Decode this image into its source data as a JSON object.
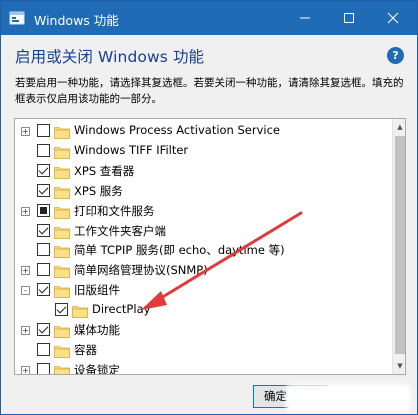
{
  "window": {
    "title": "Windows 功能",
    "heading": "启用或关闭 Windows 功能",
    "description": "若要启用一种功能，请选择其复选框。若要关闭一种功能，请清除其复选框。填充的框表示仅启用该功能的一部分。",
    "help_icon": "question-icon",
    "accent_color": "#1f6bb6"
  },
  "features": [
    {
      "label": "Windows Process Activation Service",
      "expander": "+",
      "state": "unchecked"
    },
    {
      "label": "Windows TIFF IFilter",
      "expander": "",
      "state": "unchecked"
    },
    {
      "label": "XPS 查看器",
      "expander": "",
      "state": "checked"
    },
    {
      "label": "XPS 服务",
      "expander": "",
      "state": "checked"
    },
    {
      "label": "打印和文件服务",
      "expander": "+",
      "state": "partial"
    },
    {
      "label": "工作文件夹客户端",
      "expander": "",
      "state": "checked"
    },
    {
      "label": "简单 TCPIP 服务(即 echo、daytime 等)",
      "expander": "",
      "state": "unchecked"
    },
    {
      "label": "简单网络管理协议(SNMP)",
      "expander": "+",
      "state": "unchecked"
    },
    {
      "label": "旧版组件",
      "expander": "-",
      "state": "checked"
    },
    {
      "label": "DirectPlay",
      "expander": "",
      "state": "checked",
      "indent": true
    },
    {
      "label": "媒体功能",
      "expander": "+",
      "state": "checked"
    },
    {
      "label": "容器",
      "expander": "",
      "state": "unchecked"
    },
    {
      "label": "设备锁定",
      "expander": "+",
      "state": "unchecked"
    }
  ],
  "buttons": {
    "ok_label": "确定"
  }
}
